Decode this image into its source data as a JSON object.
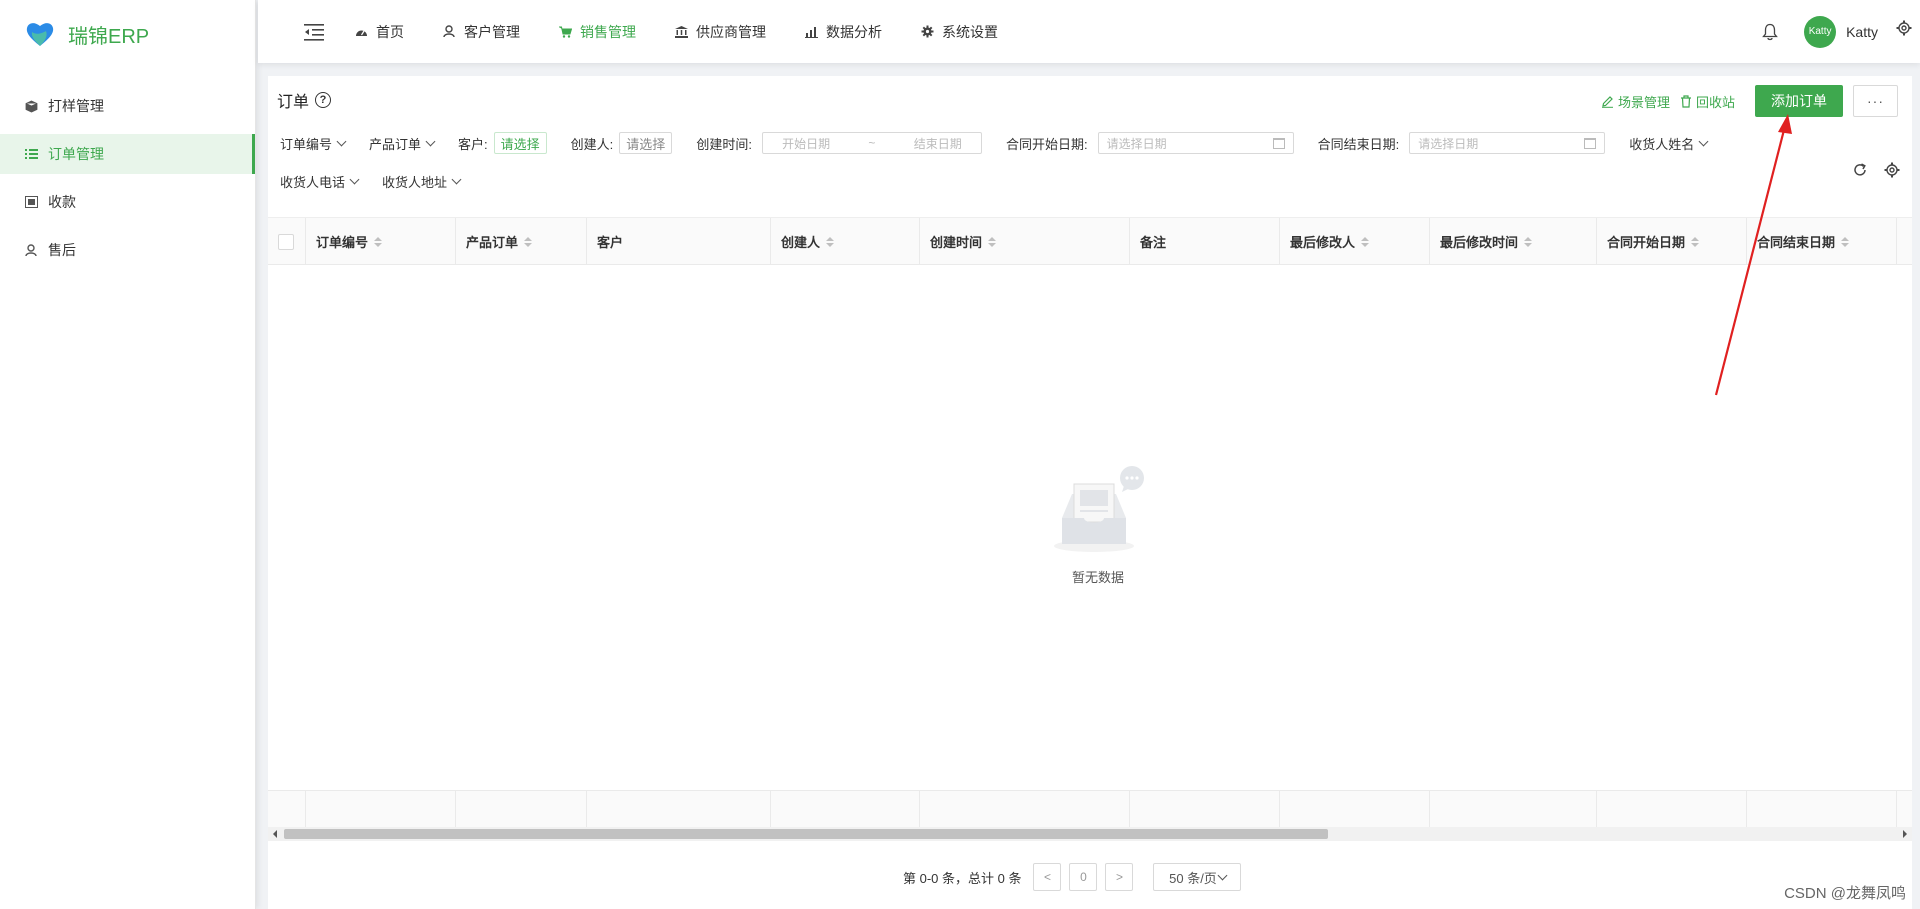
{
  "app": {
    "brand": "瑞锦ERP"
  },
  "sidebar": {
    "items": [
      {
        "label": "打样管理",
        "icon": "cube-icon",
        "active": false
      },
      {
        "label": "订单管理",
        "icon": "list-icon",
        "active": true
      },
      {
        "label": "收款",
        "icon": "money-icon",
        "active": false
      },
      {
        "label": "售后",
        "icon": "user-icon",
        "active": false
      }
    ]
  },
  "header": {
    "nav": [
      {
        "label": "首页",
        "icon": "dashboard-icon",
        "active": false
      },
      {
        "label": "客户管理",
        "icon": "users-icon",
        "active": false
      },
      {
        "label": "销售管理",
        "icon": "cart-icon",
        "active": true
      },
      {
        "label": "供应商管理",
        "icon": "bank-icon",
        "active": false
      },
      {
        "label": "数据分析",
        "icon": "bar-chart-icon",
        "active": false
      },
      {
        "label": "系统设置",
        "icon": "gear-icon",
        "active": false
      }
    ],
    "username": "Katty",
    "avatar_text": "Katty"
  },
  "page": {
    "title": "订单",
    "actions": {
      "scene_label": "场景管理",
      "recycle_label": "回收站",
      "add_label": "添加订单",
      "more_label": "···"
    }
  },
  "filters": {
    "order_no": "订单编号",
    "product_order": "产品订单",
    "customer_label": "客户:",
    "customer_value": "请选择",
    "creator_label": "创建人:",
    "creator_value": "请选择",
    "created_time_label": "创建时间:",
    "range_start": "开始日期",
    "range_sep": "~",
    "range_end": "结束日期",
    "contract_start_label": "合同开始日期:",
    "contract_start_placeholder": "请选择日期",
    "contract_end_label": "合同结束日期:",
    "contract_end_placeholder": "请选择日期",
    "receiver_name": "收货人姓名",
    "receiver_phone": "收货人电话",
    "receiver_address": "收货人地址"
  },
  "table": {
    "columns": [
      {
        "label": "订单编号",
        "sortable": true
      },
      {
        "label": "产品订单",
        "sortable": true
      },
      {
        "label": "客户",
        "sortable": false
      },
      {
        "label": "创建人",
        "sortable": true
      },
      {
        "label": "创建时间",
        "sortable": true
      },
      {
        "label": "备注",
        "sortable": false
      },
      {
        "label": "最后修改人",
        "sortable": true
      },
      {
        "label": "最后修改时间",
        "sortable": true
      },
      {
        "label": "合同开始日期",
        "sortable": true
      },
      {
        "label": "合同结束日期",
        "sortable": true
      }
    ],
    "empty_text": "暂无数据"
  },
  "pagination": {
    "summary": "第 0-0 条，总计 0 条",
    "page": "0",
    "prev": "<",
    "next": ">",
    "page_size": "50 条/页"
  },
  "watermark": "CSDN @龙舞凤鸣",
  "colors": {
    "accent": "#3ea84e",
    "annotation_arrow": "#e02020"
  }
}
